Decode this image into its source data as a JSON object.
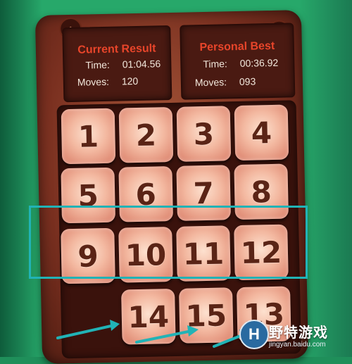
{
  "current": {
    "title": "Current Result",
    "time_label": "Time:",
    "time_value": "01:04.56",
    "moves_label": "Moves:",
    "moves_value": "120"
  },
  "best": {
    "title": "Personal Best",
    "time_label": "Time:",
    "time_value": "00:36.92",
    "moves_label": "Moves:",
    "moves_value": "093"
  },
  "icons": {
    "home": "home-icon",
    "sound": "speaker-icon"
  },
  "tiles": [
    "1",
    "2",
    "3",
    "4",
    "5",
    "6",
    "7",
    "8",
    "9",
    "10",
    "11",
    "12",
    "",
    "14",
    "15",
    "13"
  ],
  "colors": {
    "highlight": "#21b3b6",
    "panel_title": "#e8452a",
    "tile_text": "#5a2416"
  },
  "watermark": {
    "brand": "野特游戏",
    "url": "jingyan.baidu.com"
  }
}
